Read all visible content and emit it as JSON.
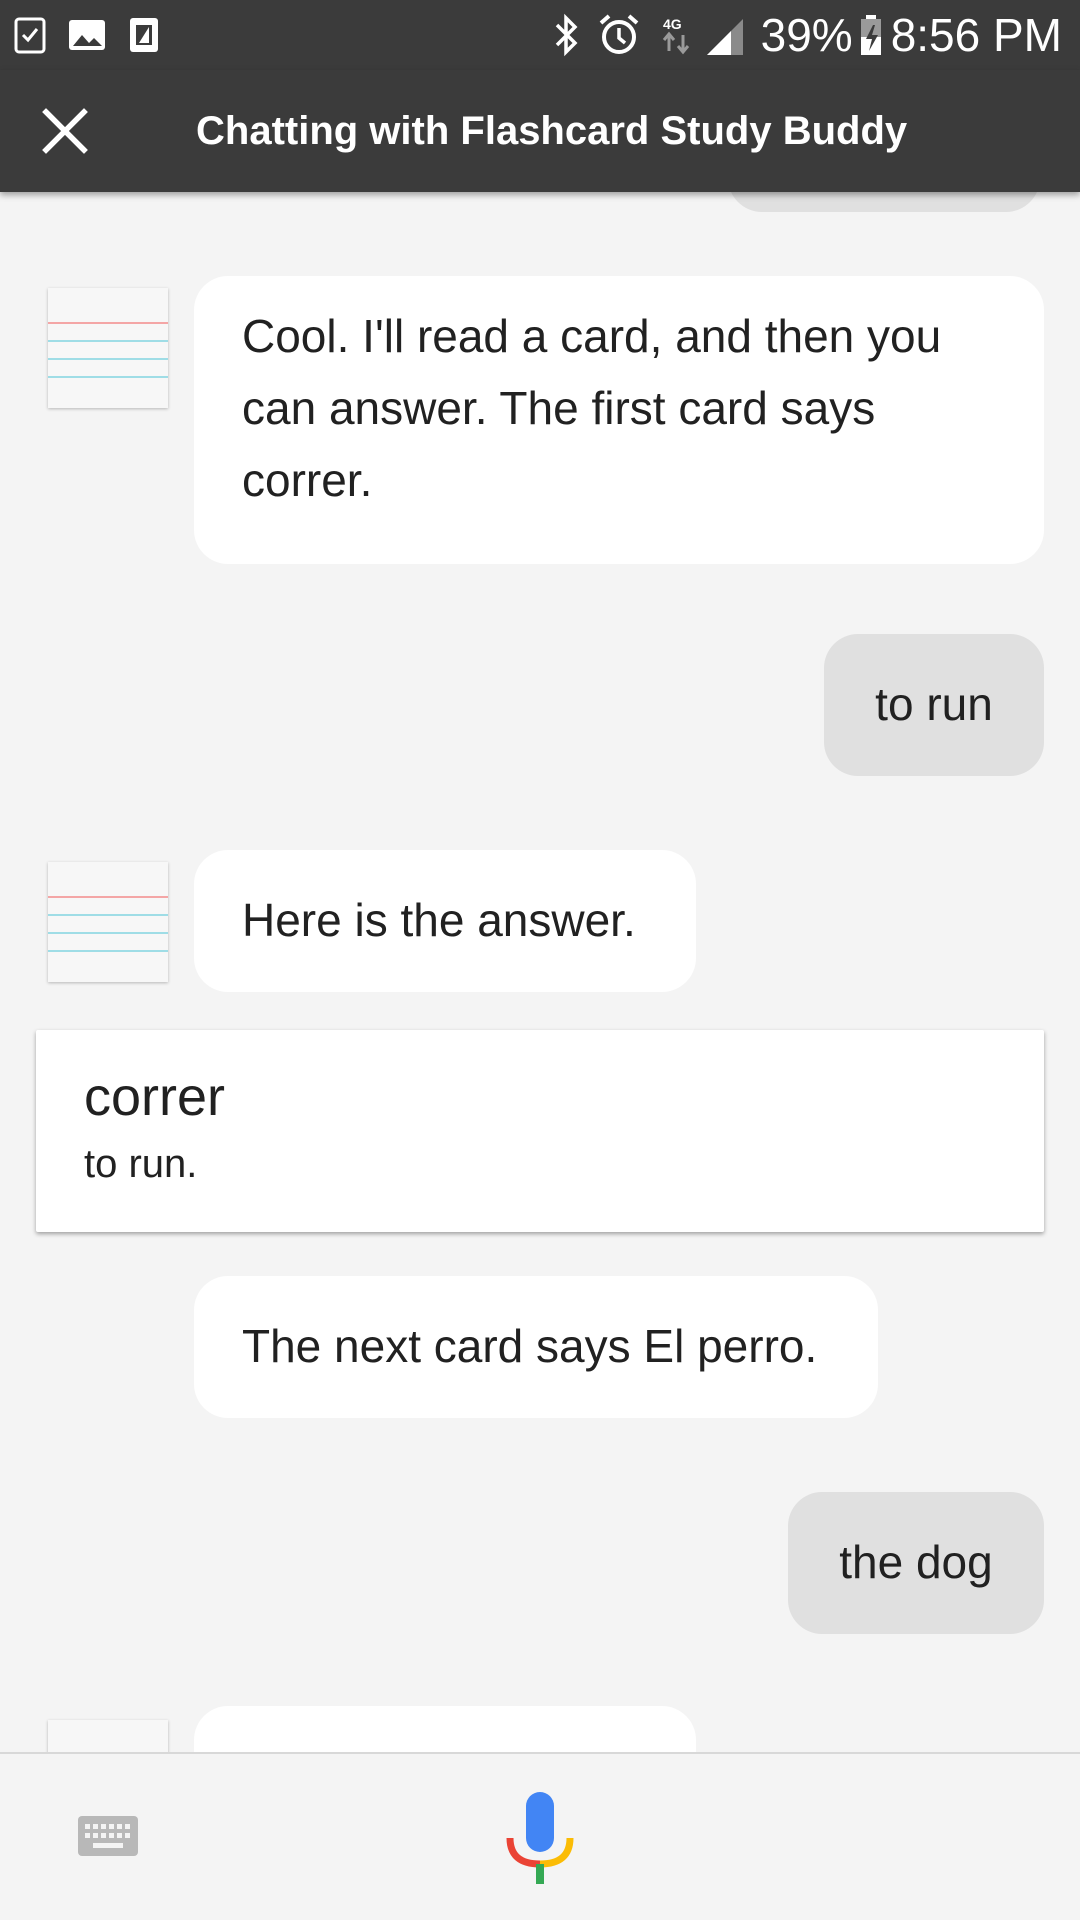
{
  "status_bar": {
    "battery": "39%",
    "time": "8:56 PM",
    "network": "4G",
    "icons": [
      "task-icon",
      "image-icon",
      "sim-icon",
      "bluetooth-icon",
      "alarm-icon",
      "data-arrows-icon",
      "signal-icon",
      "battery-charging-icon"
    ]
  },
  "app_bar": {
    "title": "Chatting with Flashcard Study Buddy",
    "close_icon": "close-icon"
  },
  "messages": [
    {
      "from": "bot",
      "lines": [
        "Cool. I'll read a card, and then you",
        "can answer. The first card says",
        "correr."
      ]
    },
    {
      "from": "user",
      "text": "to run"
    },
    {
      "from": "bot",
      "text": "Here is the answer."
    },
    {
      "from": "card",
      "title": "correr",
      "subtitle": "to run."
    },
    {
      "from": "bot",
      "text": "The next card says El perro."
    },
    {
      "from": "user",
      "text": "the dog"
    }
  ],
  "bottom_bar": {
    "keyboard_icon": "keyboard-icon",
    "mic_icon": "microphone-icon"
  },
  "colors": {
    "bar_background": "#3b3b3b",
    "chat_background": "#f4f4f4",
    "bot_bubble": "#ffffff",
    "user_bubble": "#e0e0e0",
    "avatar_red_line": "#f4a6a6",
    "avatar_blue_line": "#9fdde6",
    "mic_blue": "#4285f4",
    "mic_red": "#ea4335",
    "mic_yellow": "#fbbc05",
    "mic_green": "#34a853"
  }
}
